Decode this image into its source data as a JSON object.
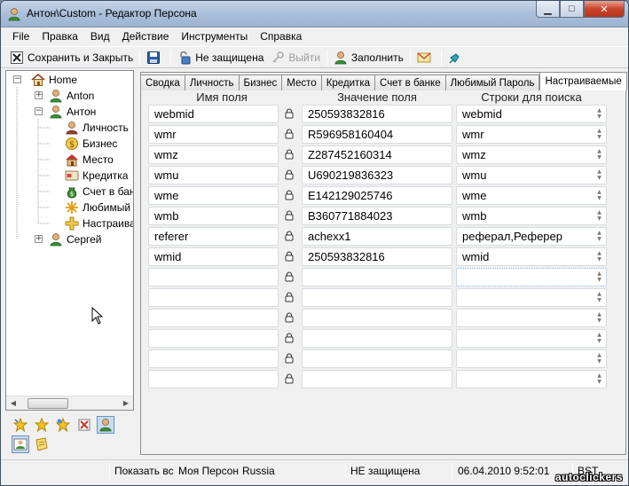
{
  "window": {
    "title": "Антон\\Custom - Редактор Персона",
    "minimize": "▁",
    "maximize": "□",
    "close": "✕"
  },
  "menu": [
    "File",
    "Правка",
    "Вид",
    "Действие",
    "Инструменты",
    "Справка"
  ],
  "toolbar": {
    "save_close": "Сохранить и Закрыть",
    "not_protected": "Не защищена",
    "logout": "Выйти",
    "fill": "Заполнить"
  },
  "tree": {
    "items": [
      {
        "label": "Home",
        "icon": "home-icon"
      },
      {
        "label": "Anton",
        "icon": "person-icon"
      },
      {
        "label": "Антон",
        "icon": "person-icon"
      },
      {
        "label": "Личность",
        "icon": "person-icon"
      },
      {
        "label": "Бизнес",
        "icon": "dollar-icon"
      },
      {
        "label": "Место",
        "icon": "house-icon"
      },
      {
        "label": "Кредитка",
        "icon": "credit-card-icon"
      },
      {
        "label": "Счет в банк",
        "icon": "money-bag-icon"
      },
      {
        "label": "Любимый",
        "icon": "snowflake-icon"
      },
      {
        "label": "Настраива",
        "icon": "plus-icon"
      },
      {
        "label": "Сергей",
        "icon": "person-icon"
      }
    ]
  },
  "tabs": [
    "Сводка",
    "Личность",
    "Бизнес",
    "Место",
    "Кредитка",
    "Счет в банке",
    "Любимый Пароль",
    "Настраиваемые"
  ],
  "active_tab": "Настраиваемые",
  "grid": {
    "headers": [
      "Имя поля",
      "Значение поля",
      "Строки для поиска"
    ],
    "rows": [
      {
        "name": "webmid",
        "value": "250593832816",
        "search": "webmid"
      },
      {
        "name": "wmr",
        "value": "R596958160404",
        "search": "wmr"
      },
      {
        "name": "wmz",
        "value": "Z287452160314",
        "search": "wmz"
      },
      {
        "name": "wmu",
        "value": "U690219836323",
        "search": "wmu"
      },
      {
        "name": "wme",
        "value": "E142129025746",
        "search": "wme"
      },
      {
        "name": "wmb",
        "value": "B360771884023",
        "search": "wmb"
      },
      {
        "name": "referer",
        "value": "achexx1",
        "search": "реферал,Реферер"
      },
      {
        "name": "wmid",
        "value": "250593832816",
        "search": "wmid"
      },
      {
        "name": "",
        "value": "",
        "search": ""
      },
      {
        "name": "",
        "value": "",
        "search": ""
      },
      {
        "name": "",
        "value": "",
        "search": ""
      },
      {
        "name": "",
        "value": "",
        "search": ""
      },
      {
        "name": "",
        "value": "",
        "search": ""
      },
      {
        "name": "",
        "value": "",
        "search": ""
      }
    ]
  },
  "status": {
    "show": "Показать все",
    "identity": "Моя Персона",
    "country": "Russia",
    "protection": "НЕ защищена",
    "datetime": "06.04.2010 9:52:01",
    "timezone": "BST"
  },
  "watermark": "autoclickers",
  "colors": {
    "accent": "#3b6ea5",
    "titlebar": "#b4c7df"
  }
}
